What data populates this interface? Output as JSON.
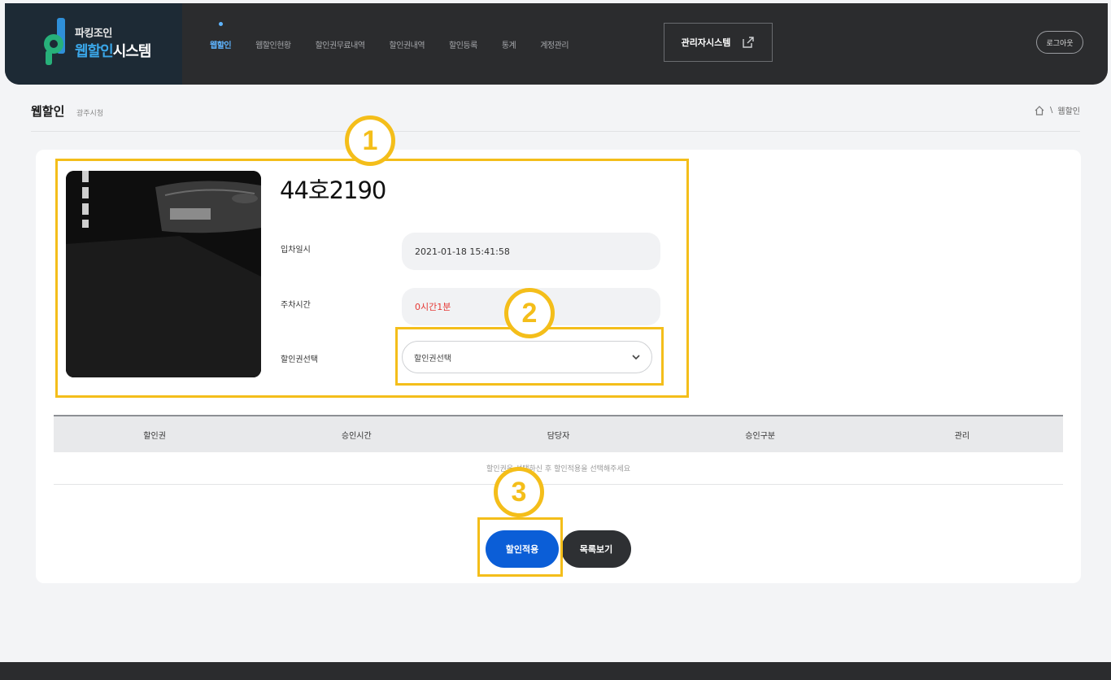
{
  "brand": {
    "line1": "파킹조인",
    "line2_accent": "웹할인",
    "line2_rest": "시스템"
  },
  "nav": {
    "items": [
      {
        "label": "웹할인"
      },
      {
        "label": "웹할인현황"
      },
      {
        "label": "할인권무료내역"
      },
      {
        "label": "할인권내역"
      },
      {
        "label": "할인등록"
      },
      {
        "label": "통계"
      },
      {
        "label": "계정관리"
      }
    ],
    "admin_label": "관리자시스템",
    "logout_label": "로그아웃"
  },
  "page": {
    "title": "웹할인",
    "subtitle": "광주시청",
    "breadcrumb_current": "웹할인"
  },
  "vehicle": {
    "plate": "44호2190",
    "entry_label": "입차일시",
    "entry_value": "2021-01-18 15:41:58",
    "duration_label": "주차시간",
    "duration_value": "0시간1분",
    "coupon_label": "할인권선택",
    "coupon_selected": "할인권선택"
  },
  "table": {
    "headers": [
      "할인권",
      "승인시간",
      "담당자",
      "승인구분",
      "관리"
    ],
    "empty_message": "할인권을 선택하신 후 할인적용을 선택해주세요"
  },
  "buttons": {
    "apply": "할인적용",
    "list": "목록보기"
  },
  "annotations": [
    "1",
    "2",
    "3"
  ],
  "colors": {
    "highlight": "#f4be1a",
    "primary": "#0b5ed7",
    "header_bg": "#2b2c2e",
    "accent": "#3aa6e8"
  }
}
